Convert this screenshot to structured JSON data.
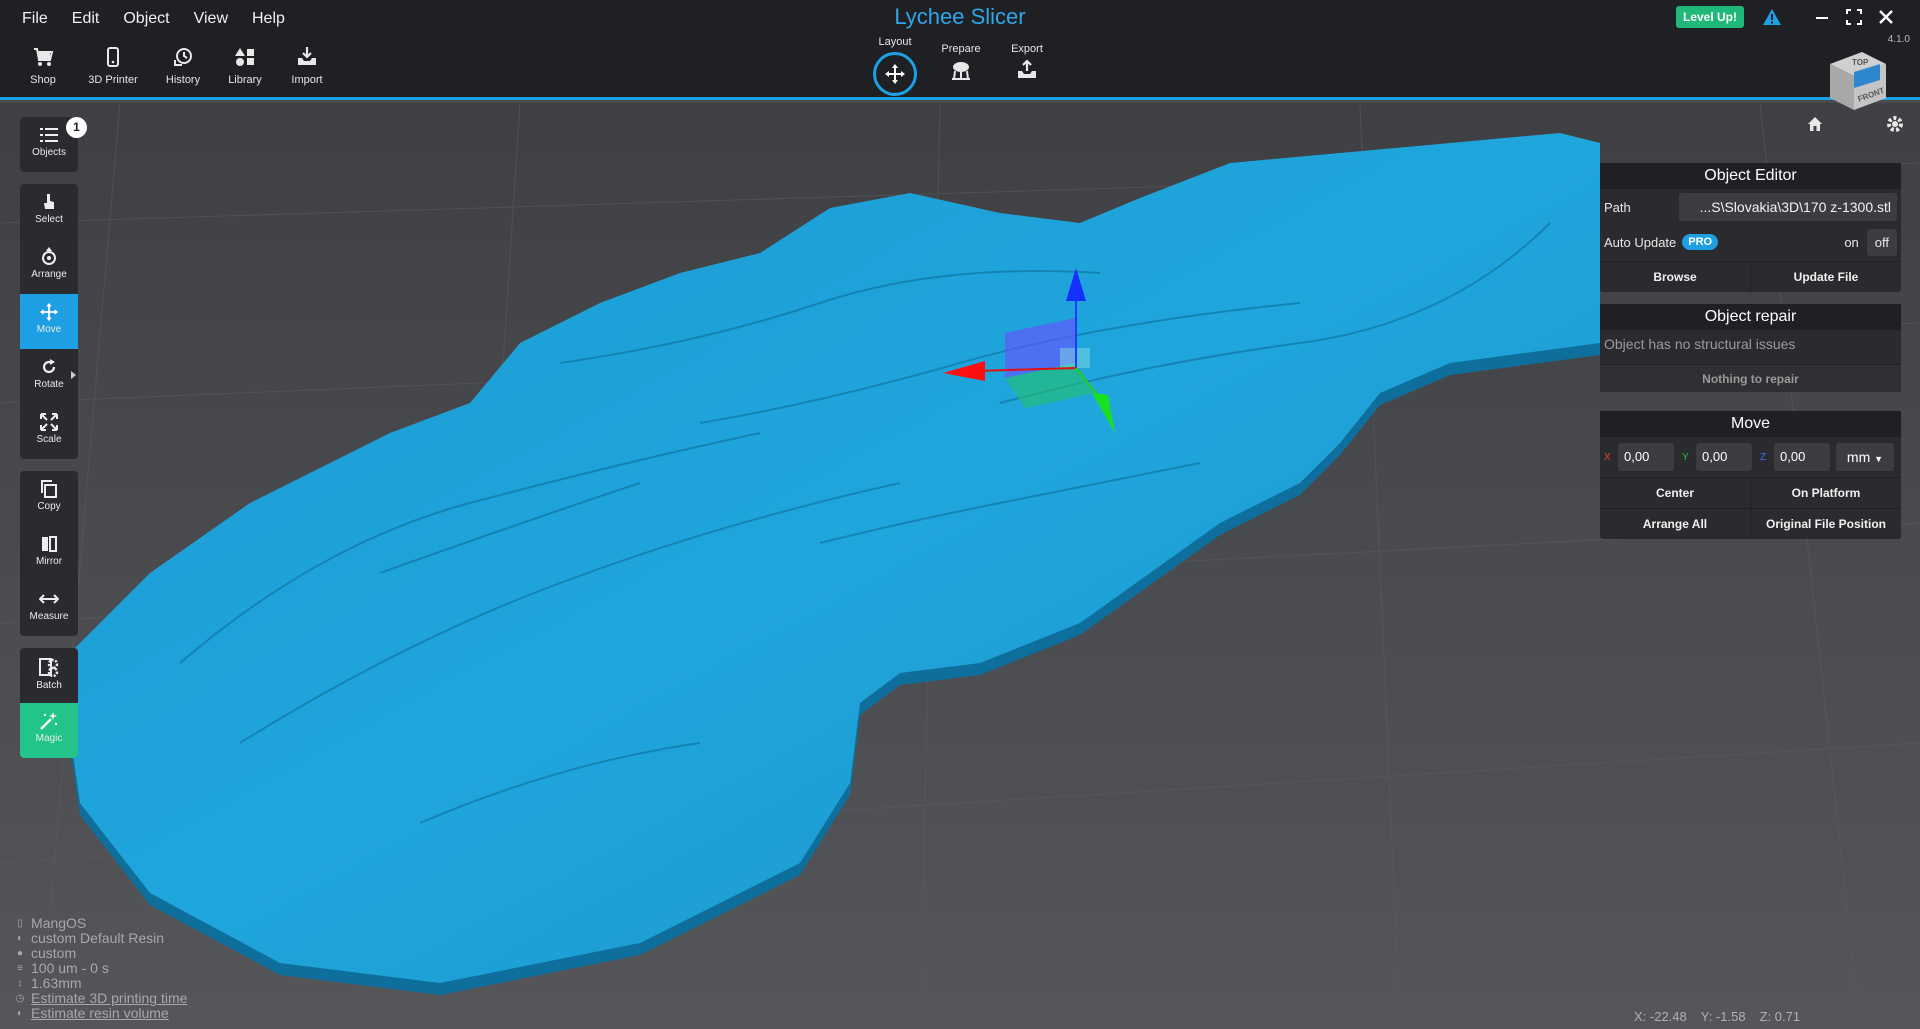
{
  "menu": [
    "File",
    "Edit",
    "Object",
    "View",
    "Help"
  ],
  "app_title": "Lychee Slicer",
  "toolbar": [
    "Shop",
    "3D Printer",
    "History",
    "Library",
    "Import"
  ],
  "tabs": {
    "layout": "Layout",
    "prepare": "Prepare",
    "export": "Export"
  },
  "level_up": "Level Up!",
  "version": "4.1.0",
  "viewcube": {
    "top": "TOP",
    "front": "FRONT"
  },
  "left_toolbar": {
    "objects": "Objects",
    "objects_count": "1",
    "select": "Select",
    "arrange": "Arrange",
    "move": "Move",
    "rotate": "Rotate",
    "scale": "Scale",
    "copy": "Copy",
    "mirror": "Mirror",
    "measure": "Measure",
    "batch": "Batch",
    "magic": "Magic"
  },
  "object_editor": {
    "title": "Object Editor",
    "path_label": "Path",
    "path_value": "...S\\Slovakia\\3D\\170 z-1300.stl",
    "auto_update_label": "Auto Update",
    "pro_badge": "PRO",
    "toggle_on": "on",
    "toggle_off": "off",
    "browse": "Browse",
    "update_file": "Update File"
  },
  "object_repair": {
    "title": "Object repair",
    "message": "Object has no structural issues",
    "button": "Nothing to repair"
  },
  "move_panel": {
    "title": "Move",
    "x_label": "X",
    "x_value": "0,00",
    "y_label": "Y",
    "y_value": "0,00",
    "z_label": "Z",
    "z_value": "0,00",
    "unit": "mm",
    "center": "Center",
    "on_platform": "On Platform",
    "arrange_all": "Arrange All",
    "original_position": "Original File Position"
  },
  "printer_info": {
    "printer": "MangOS",
    "resin": "custom Default Resin",
    "profile": "custom",
    "layers": "100 um - 0 s",
    "height": "1.63mm",
    "estimate_time": "Estimate 3D printing time",
    "estimate_volume": "Estimate resin volume"
  },
  "cursor": {
    "x": "X: -22.48",
    "y": "Y: -1.58",
    "z": "Z: 0.71"
  },
  "colors": {
    "accent": "#1ea0e6",
    "model": "#1ea3d8",
    "magic": "#22c48a",
    "levelup": "#1fb878"
  }
}
